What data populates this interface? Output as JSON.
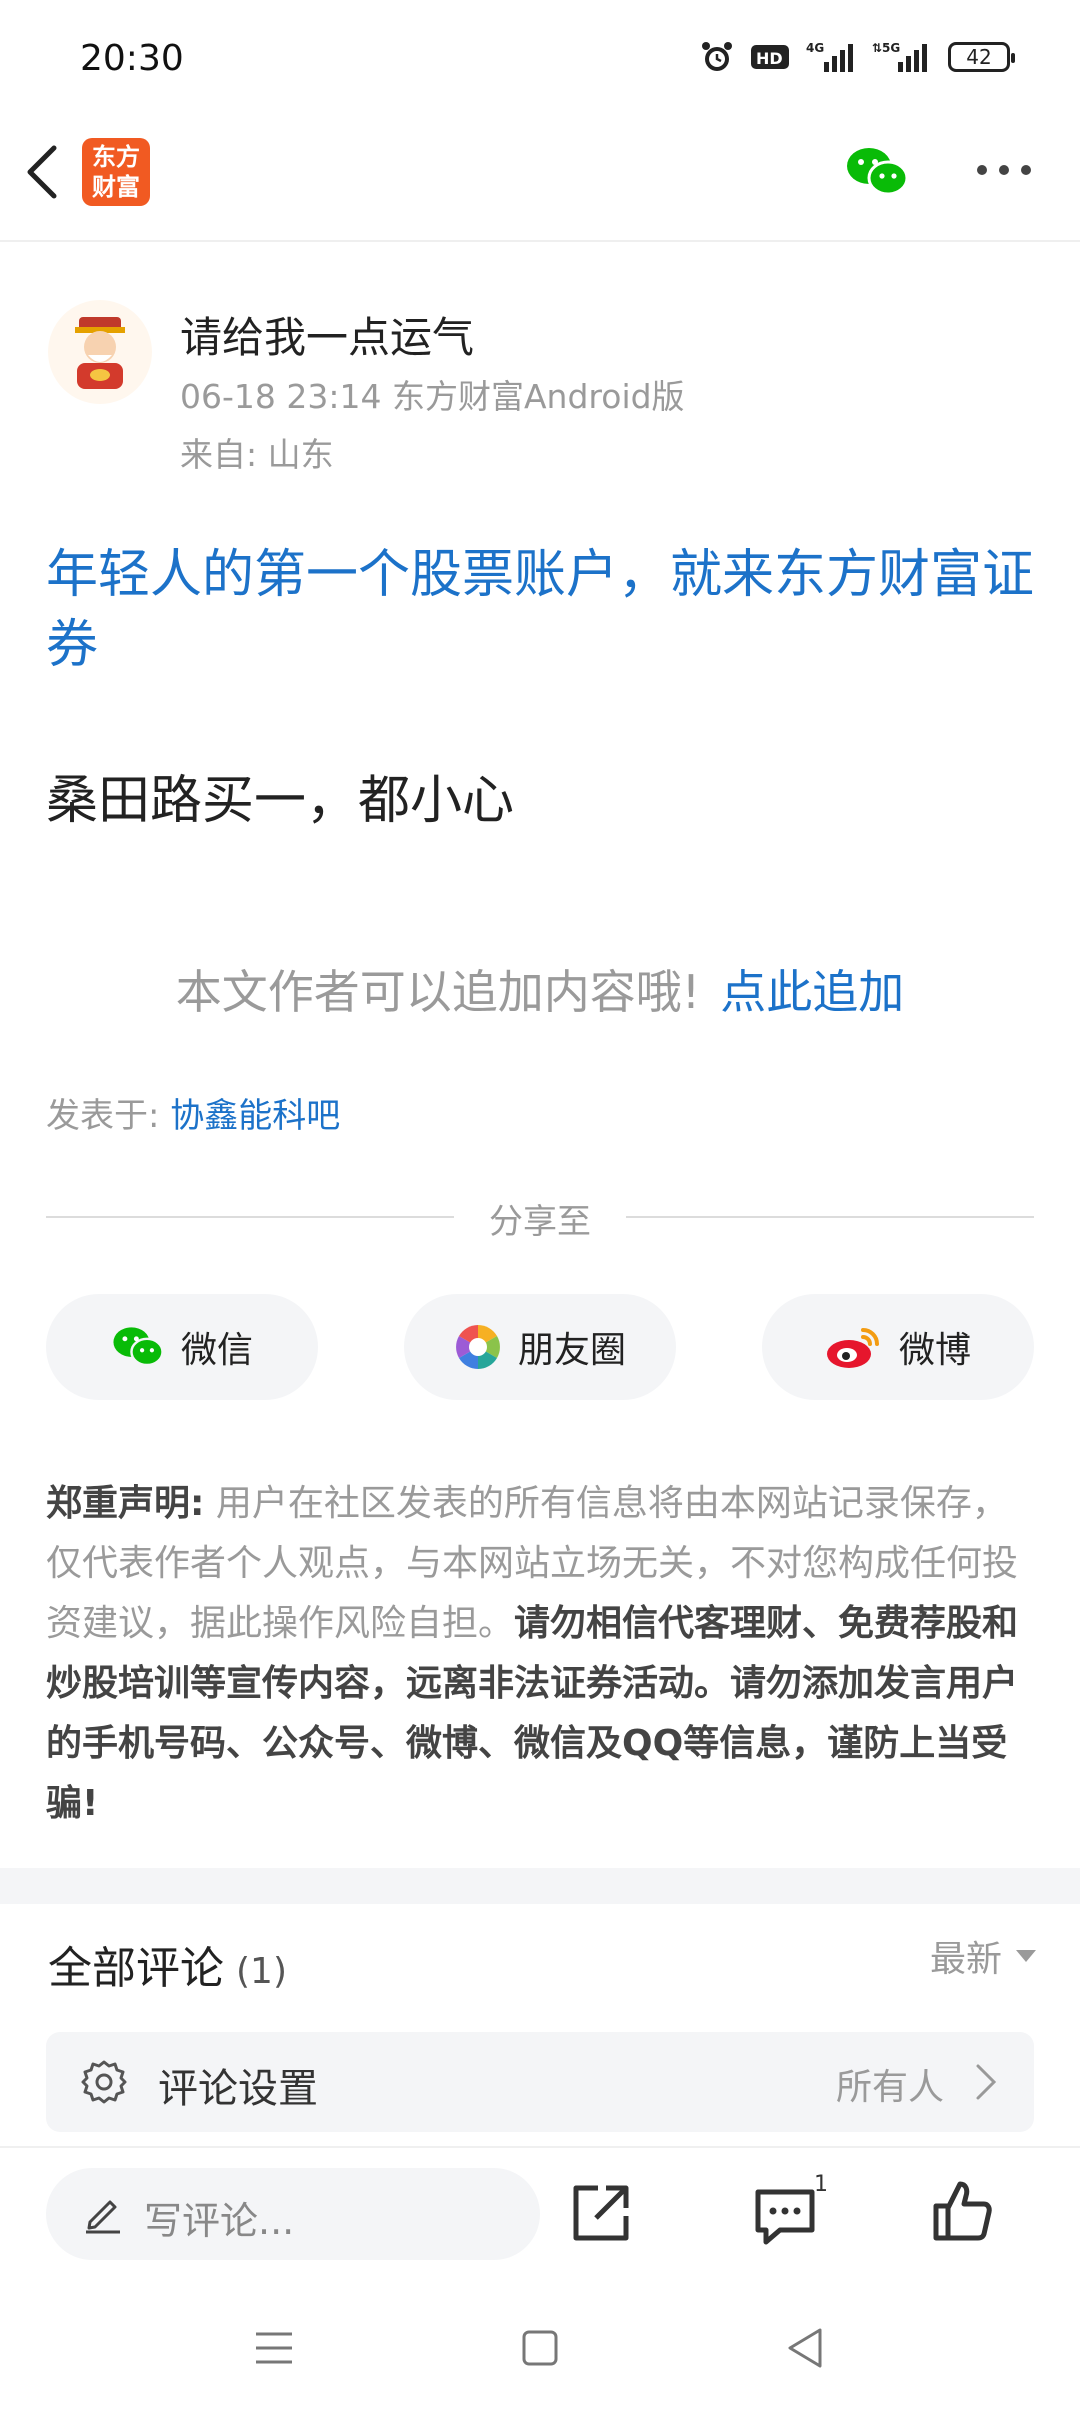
{
  "status_bar": {
    "time": "20:30",
    "icons": [
      "alarm-icon",
      "hd-icon",
      "signal-4g-icon",
      "signal-5g-icon"
    ],
    "battery": "42"
  },
  "header": {
    "logo_line1": "东方",
    "logo_line2": "财富",
    "brand_color": "#f15a22"
  },
  "post": {
    "author": "请给我一点运气",
    "meta": "06-18 23:14 东方财富Android版",
    "from": "来自: 山东",
    "promo": "年轻人的第一个股票账户，就来东方财富证券",
    "body": "桑田路买一，都小心",
    "append_hint": "本文作者可以追加内容哦!",
    "append_link": "点此追加",
    "posted_in_label": "发表于: ",
    "forum": "协鑫能科吧"
  },
  "share": {
    "label": "分享至",
    "wechat": "微信",
    "moments": "朋友圈",
    "weibo": "微博"
  },
  "disclaimer": {
    "title": "郑重声明",
    "colon": ":",
    "normal": " 用户在社区发表的所有信息将由本网站记录保存，仅代表作者个人观点，与本网站立场无关，不对您构成任何投资建议，据此操作风险自担。",
    "bold": "请勿相信代客理财、免费荐股和炒股培训等宣传内容，远离非法证券活动。请勿添加发言用户的手机号码、公众号、微博、微信及QQ等信息，谨防上当受骗!"
  },
  "comments": {
    "title": "全部评论",
    "count": "(1)",
    "sort": "最新",
    "setting_label": "评论设置",
    "setting_value": "所有人"
  },
  "bottom_bar": {
    "placeholder": "写评论...",
    "comment_badge": "1"
  },
  "colors": {
    "link_blue": "#1c72c9",
    "wechat_green": "#09bb07",
    "weibo_red": "#e6162d"
  }
}
